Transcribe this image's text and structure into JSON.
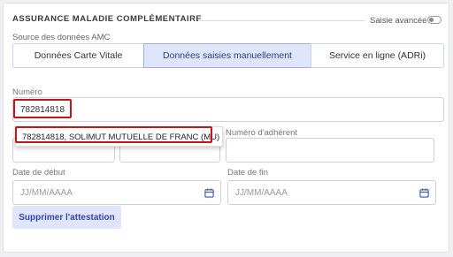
{
  "section": {
    "title": "ASSURANCE MALADIE COMPLÉMENTAIRE",
    "toggle_label": "Saisie avancée"
  },
  "source": {
    "label": "Source des données AMC",
    "options": [
      {
        "label": "Données Carte Vitale",
        "selected": false
      },
      {
        "label": "Données saisies manuellement",
        "selected": true
      },
      {
        "label": "Service en ligne (ADRi)",
        "selected": false
      }
    ]
  },
  "numero": {
    "label": "Numéro",
    "value": "782814818"
  },
  "suggestion": {
    "text": "782814818, SOLIMUT MUTUELLE DE FRANC (MU)"
  },
  "adherent": {
    "label": "Numéro d'adhérent",
    "value": ""
  },
  "date_debut": {
    "label": "Date de début",
    "placeholder": "JJ/MM/AAAA"
  },
  "date_fin": {
    "label": "Date de fin",
    "placeholder": "JJ/MM/AAAA"
  },
  "actions": {
    "delete_label": "Supprimer l'attestation"
  },
  "colors": {
    "accent": "#3447a3",
    "selected_bg": "#dfe5fb",
    "highlight": "#c0161c"
  }
}
